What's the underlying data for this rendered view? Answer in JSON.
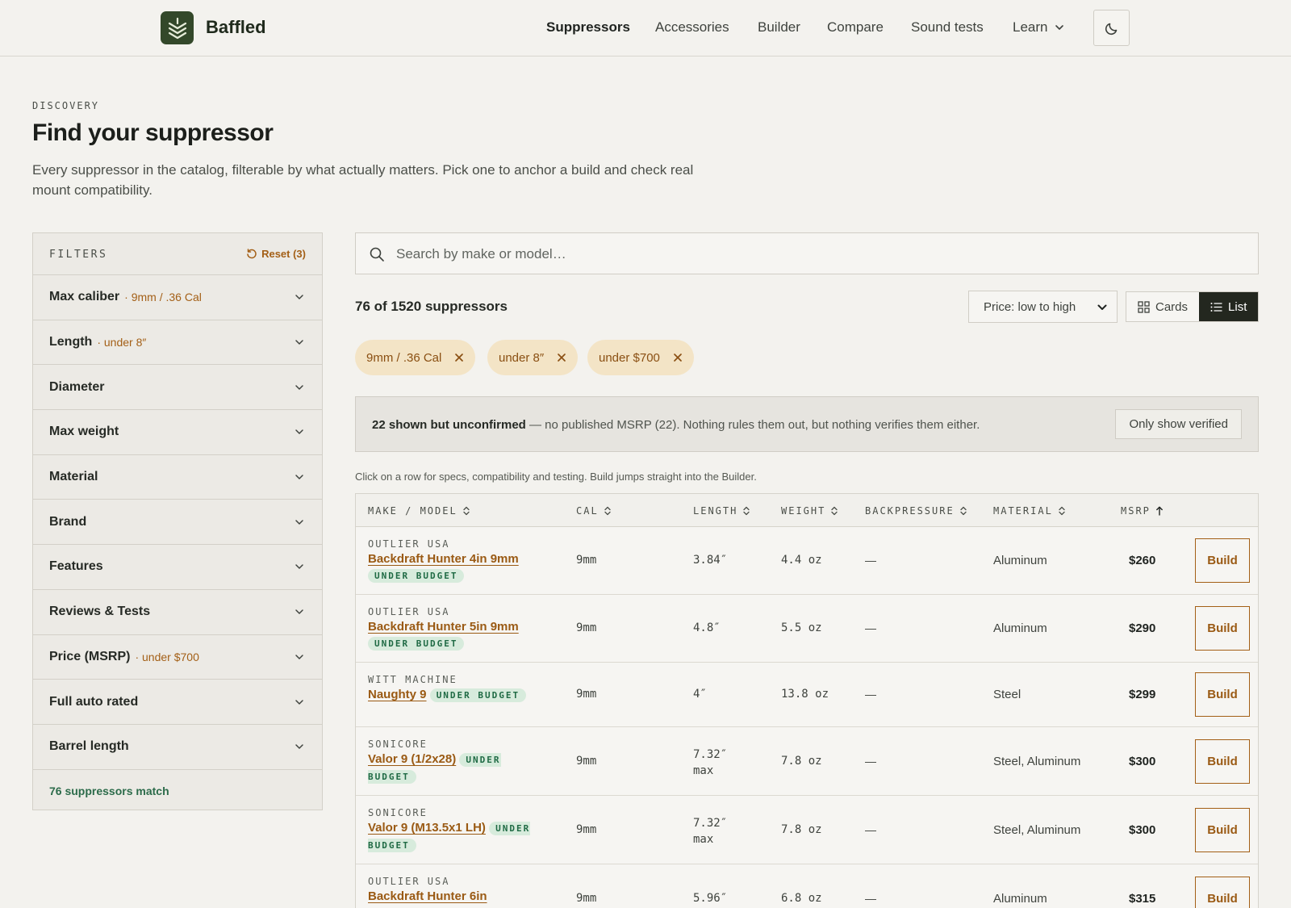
{
  "header": {
    "brand": "Baffled",
    "nav": [
      "Suppressors",
      "Accessories",
      "Builder",
      "Compare",
      "Sound tests",
      "Learn"
    ],
    "active_nav": "Suppressors"
  },
  "hero": {
    "eyebrow": "DISCOVERY",
    "title": "Find your suppressor",
    "lead": "Every suppressor in the catalog, filterable by what actually matters. Pick one to anchor a build and check real mount compatibility."
  },
  "filters": {
    "title": "FILTERS",
    "reset": "Reset (3)",
    "items": [
      {
        "label": "Max caliber",
        "value": "· 9mm / .36 Cal"
      },
      {
        "label": "Length",
        "value": "· under 8″"
      },
      {
        "label": "Diameter",
        "value": ""
      },
      {
        "label": "Max weight",
        "value": ""
      },
      {
        "label": "Material",
        "value": ""
      },
      {
        "label": "Brand",
        "value": ""
      },
      {
        "label": "Features",
        "value": ""
      },
      {
        "label": "Reviews & Tests",
        "value": ""
      },
      {
        "label": "Price (MSRP)",
        "value": "· under $700"
      },
      {
        "label": "Full auto rated",
        "value": ""
      },
      {
        "label": "Barrel length",
        "value": ""
      }
    ],
    "match": "76 suppressors match"
  },
  "search": {
    "placeholder": "Search by make or model…",
    "value": ""
  },
  "results": {
    "count": "76 of 1520 suppressors",
    "sort": "Price: low to high",
    "view_cards": "Cards",
    "view_list": "List",
    "active_view": "List"
  },
  "chips": [
    "9mm / .36 Cal",
    "under 8″",
    "under $700"
  ],
  "notice": {
    "bold": "22 shown but unconfirmed",
    "text": " — no published MSRP (22). Nothing rules them out, but nothing verifies them either.",
    "button": "Only show verified"
  },
  "hint": "Click on a row for specs, compatibility and testing. Build jumps straight into the Builder.",
  "table": {
    "headers": [
      "MAKE / MODEL",
      "CAL",
      "LENGTH",
      "WEIGHT",
      "BACKPRESSURE",
      "MATERIAL",
      "MSRP"
    ],
    "badge": "UNDER BUDGET",
    "build_label": "Build",
    "rows": [
      {
        "maker": "OUTLIER USA",
        "model": "Backdraft Hunter 4in 9mm",
        "cal": "9mm",
        "length": "3.84″",
        "length_note": "",
        "weight": "4.4 oz",
        "backpressure": "—",
        "material": "Aluminum",
        "msrp": "$260"
      },
      {
        "maker": "OUTLIER USA",
        "model": "Backdraft Hunter 5in 9mm",
        "cal": "9mm",
        "length": "4.8″",
        "length_note": "",
        "weight": "5.5 oz",
        "backpressure": "—",
        "material": "Aluminum",
        "msrp": "$290"
      },
      {
        "maker": "WITT MACHINE",
        "model": "Naughty 9",
        "cal": "9mm",
        "length": "4″",
        "length_note": "",
        "weight": "13.8 oz",
        "backpressure": "—",
        "material": "Steel",
        "msrp": "$299"
      },
      {
        "maker": "SONICORE",
        "model": "Valor 9 (1/2x28)",
        "cal": "9mm",
        "length": "7.32″",
        "length_note": "max",
        "weight": "7.8 oz",
        "backpressure": "—",
        "material": "Steel, Aluminum",
        "msrp": "$300"
      },
      {
        "maker": "SONICORE",
        "model": "Valor 9 (M13.5x1 LH)",
        "cal": "9mm",
        "length": "7.32″",
        "length_note": "max",
        "weight": "7.8 oz",
        "backpressure": "—",
        "material": "Steel, Aluminum",
        "msrp": "$300"
      },
      {
        "maker": "OUTLIER USA",
        "model": "Backdraft Hunter 6in",
        "cal": "9mm",
        "length": "5.96″",
        "length_note": "",
        "weight": "6.8 oz",
        "backpressure": "—",
        "material": "Aluminum",
        "msrp": "$315"
      }
    ]
  },
  "colors": {
    "accent": "#a35f16",
    "brand": "#33482a",
    "success": "#2c6b4a",
    "chip_bg": "#f3e4c6"
  }
}
